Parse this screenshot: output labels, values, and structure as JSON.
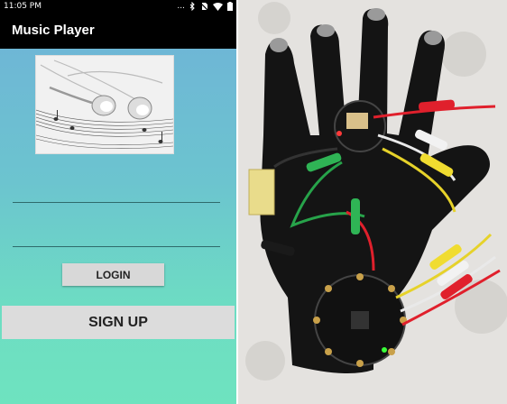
{
  "status_bar": {
    "time": "11:05 PM",
    "dots": "...",
    "icons": [
      "bluetooth-icon",
      "no-sim-icon",
      "wifi-icon",
      "battery-icon"
    ]
  },
  "app_bar": {
    "title": "Music Player"
  },
  "form": {
    "username": {
      "value": "",
      "placeholder": ""
    },
    "password": {
      "value": "",
      "placeholder": ""
    },
    "login_label": "LOGIN",
    "signup_label": "SIGN UP"
  },
  "colors": {
    "app_bar": "#000000",
    "gradient_top": "#6fb2d8",
    "gradient_bottom": "#6ee3bf",
    "button_bg": "#d8d8d8"
  },
  "photo_icons": [
    "glove-icon",
    "microcontroller-board-icon",
    "alligator-clip-wire-icon",
    "battery-icon"
  ]
}
